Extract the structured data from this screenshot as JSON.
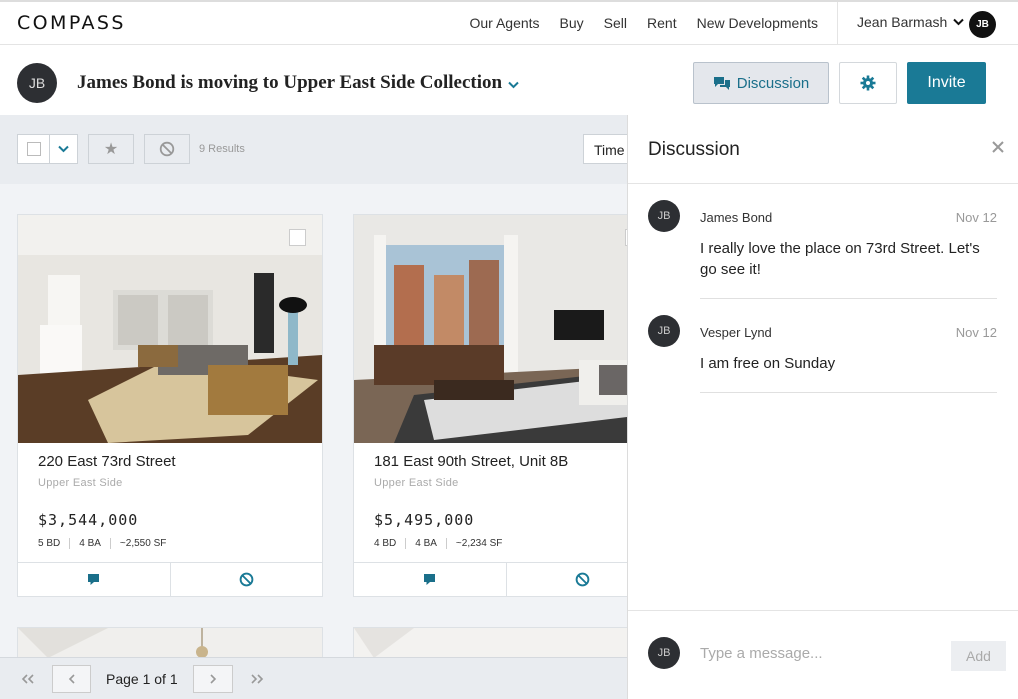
{
  "brand": {
    "logo": "COMPASS"
  },
  "nav": {
    "links": [
      "Our Agents",
      "Buy",
      "Sell",
      "Rent",
      "New Developments"
    ],
    "user_name": "Jean Barmash",
    "user_initials": "JB"
  },
  "collection": {
    "owner_initials": "JB",
    "title": "James Bond is moving to Upper East Side Collection",
    "discussion_label": "Discussion",
    "invite_label": "Invite"
  },
  "toolbar": {
    "results": "9 Results",
    "sort_label": "Time"
  },
  "listings": [
    {
      "address": "220 East 73rd Street",
      "neighborhood": "Upper East Side",
      "price": "$3,544,000",
      "beds": "5 BD",
      "baths": "4 BA",
      "sqft": "~2,550 SF"
    },
    {
      "address": "181 East 90th Street, Unit 8B",
      "neighborhood": "Upper East Side",
      "price": "$5,495,000",
      "beds": "4 BD",
      "baths": "4 BA",
      "sqft": "~2,234 SF"
    }
  ],
  "pager": {
    "label": "Page 1 of 1"
  },
  "discussion": {
    "title": "Discussion",
    "messages": [
      {
        "initials": "JB",
        "author": "James Bond",
        "date": "Nov 12",
        "text": "I really love the place on 73rd Street. Let's go see it!"
      },
      {
        "initials": "JB",
        "author": "Vesper Lynd",
        "date": "Nov 12",
        "text": "I am free on Sunday"
      }
    ],
    "composer_initials": "JB",
    "input_placeholder": "Type a message...",
    "add_label": "Add"
  },
  "colors": {
    "accent": "#1a7a96",
    "dark_avatar": "#2d2f33"
  },
  "icons": [
    "chevron-down-icon",
    "chat-bubbles-icon",
    "gear-icon",
    "star-icon",
    "block-icon",
    "close-icon",
    "comment-icon",
    "double-chevron-left-icon",
    "chevron-left-icon",
    "chevron-right-icon",
    "double-chevron-right-icon"
  ]
}
